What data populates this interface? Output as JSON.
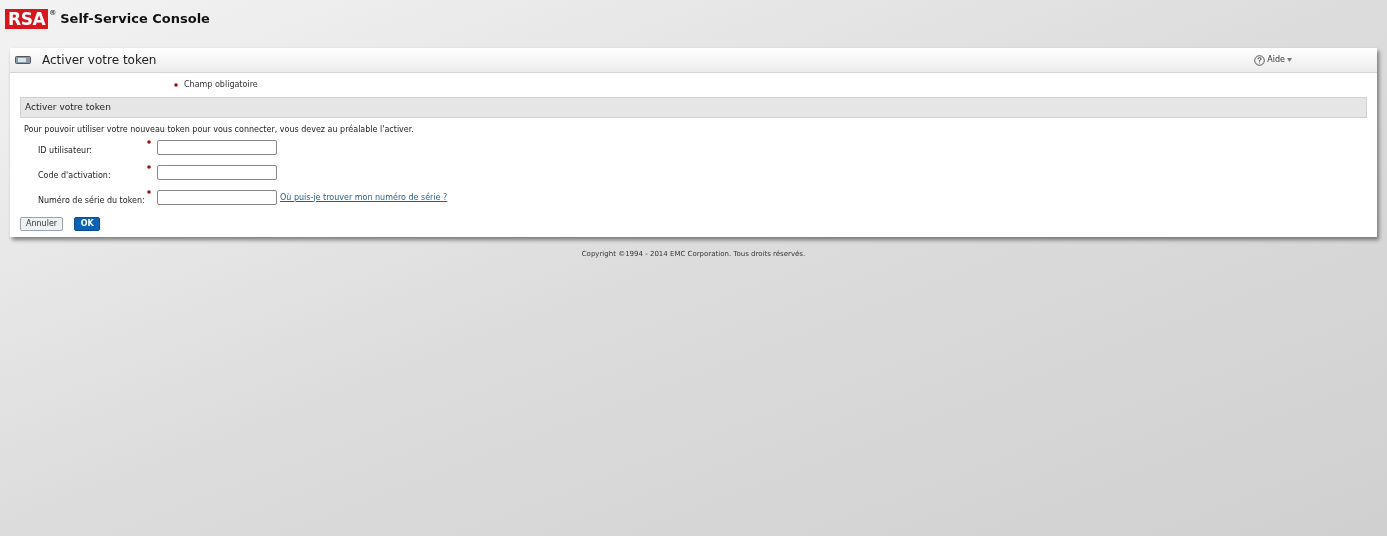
{
  "logo": {
    "mark": "RSA",
    "registered": "®",
    "title": "Self-Service Console"
  },
  "panel": {
    "title": "Activer votre token",
    "help": "Aide"
  },
  "required_note": {
    "text": "Champ obligatoire"
  },
  "section": {
    "title": "Activer votre token",
    "description": "Pour pouvoir utiliser votre nouveau token pour vous connecter, vous devez au préalable l'activer."
  },
  "fields": [
    {
      "label": "ID utilisateur:",
      "required": true
    },
    {
      "label": "Code d'activation:",
      "required": true
    },
    {
      "label": "Numéro de série du token:",
      "required": true,
      "link": "Où puis-je trouver mon numéro de série ?"
    }
  ],
  "buttons": [
    {
      "label": "Annuler",
      "kind": "secondary"
    },
    {
      "label": "OK",
      "kind": "primary"
    }
  ],
  "footer": "Copyright ©1994 - 2014 EMC Corporation. Tous droits réservés."
}
